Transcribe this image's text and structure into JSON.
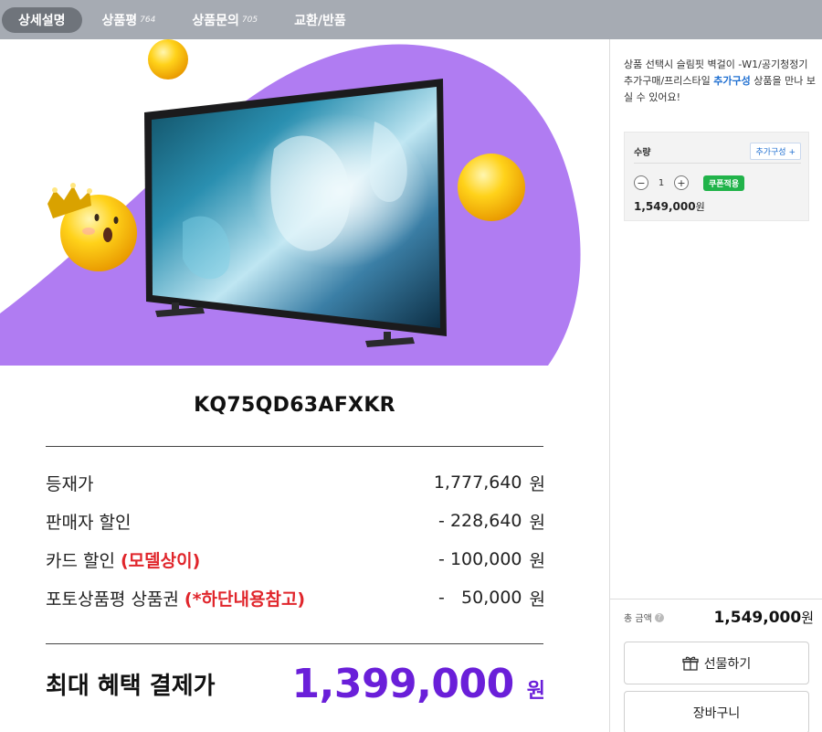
{
  "tabs": [
    {
      "label": "상세설명",
      "count": ""
    },
    {
      "label": "상품평",
      "count": "764"
    },
    {
      "label": "상품문의",
      "count": "705"
    },
    {
      "label": "교환/반품",
      "count": ""
    }
  ],
  "product": {
    "model": "KQ75QD63AFXKR"
  },
  "prices": [
    {
      "label": "등재가",
      "note": "",
      "value": "1,777,640",
      "unit": "원"
    },
    {
      "label": "판매자 할인",
      "note": "",
      "value": "- 228,640",
      "unit": "원"
    },
    {
      "label": "카드 할인 ",
      "note": "(모델상이)",
      "value": "- 100,000",
      "unit": "원"
    },
    {
      "label": "포토상품평 상품권 ",
      "note": "(*하단내용참고)",
      "value": "-   50,000",
      "unit": "원"
    }
  ],
  "final": {
    "label": "최대 혜택 결제가",
    "value": "1,399,000",
    "unit": "원"
  },
  "sidebar": {
    "notice_pre": "상품 선택시 슬림핏 벽걸이 -W1/공기청정기 추가구매/프리스타일 ",
    "notice_link": "추가구성",
    "notice_post": " 상품을 만나 보실 수 있어요!",
    "qty_label": "수량",
    "add_option": "추가구성 +",
    "minus": "−",
    "qty_value": "1",
    "plus": "+",
    "coupon": "쿠폰적용",
    "option_price": "1,549,000",
    "option_unit": "원",
    "total_label": "총 금액",
    "total_info": "?",
    "total_value": "1,549,000",
    "total_unit": "원",
    "gift_button": "선물하기",
    "cart_button": "장바구니"
  },
  "colors": {
    "tab_bar": "#a6abb3",
    "active_tab": "#6f747b",
    "accent_purple": "#6a1fd9",
    "hero_purple": "#b07cf2",
    "red_note": "#e0252b",
    "link_blue": "#1f6fd1",
    "coupon_green": "#21b34a"
  }
}
